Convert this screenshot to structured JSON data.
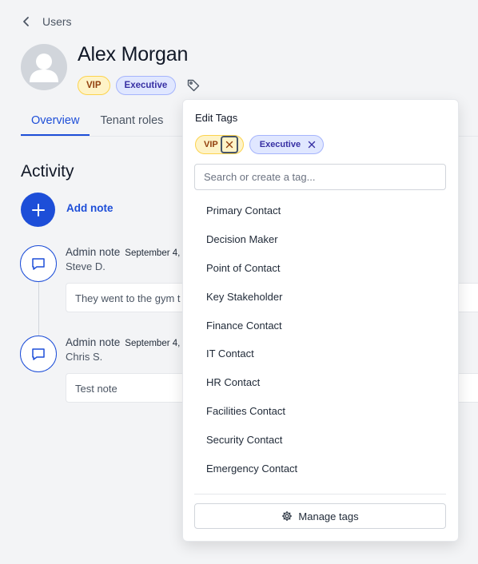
{
  "breadcrumb": {
    "back_label": "Users"
  },
  "user": {
    "name": "Alex Morgan",
    "tags": [
      "VIP",
      "Executive"
    ]
  },
  "tabs": [
    {
      "label": "Overview",
      "active": true
    },
    {
      "label": "Tenant roles",
      "active": false
    }
  ],
  "activity": {
    "title": "Activity",
    "add_note_label": "Add note",
    "notes": [
      {
        "type": "Admin note",
        "date": "September 4,",
        "author": "Steve D.",
        "text": "They went to the gym t"
      },
      {
        "type": "Admin note",
        "date": "September 4,",
        "author": "Chris S.",
        "text": "Test note"
      }
    ]
  },
  "tag_editor": {
    "title": "Edit Tags",
    "selected": [
      "VIP",
      "Executive"
    ],
    "search_placeholder": "Search or create a tag...",
    "options": [
      "Primary Contact",
      "Decision Maker",
      "Point of Contact",
      "Key Stakeholder",
      "Finance Contact",
      "IT Contact",
      "HR Contact",
      "Facilities Contact",
      "Security Contact",
      "Emergency Contact"
    ],
    "manage_label": "Manage tags"
  },
  "icons": {
    "back": "chevron-left-icon",
    "avatar": "user-silhouette-icon",
    "tag": "tag-icon",
    "add": "plus-icon",
    "note": "speech-bubble-icon",
    "remove": "close-icon",
    "manage": "gear-icon"
  },
  "colors": {
    "accent": "#1d4ed8",
    "vip_bg": "#fef3c7",
    "vip_text": "#92400e",
    "exec_bg": "#e0e7ff",
    "exec_text": "#3730a3"
  }
}
